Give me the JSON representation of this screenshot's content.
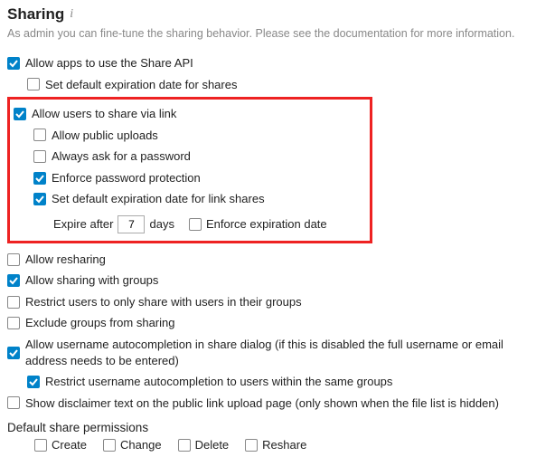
{
  "heading": "Sharing",
  "subtitle": "As admin you can fine-tune the sharing behavior. Please see the documentation for more information.",
  "options": {
    "share_api": "Allow apps to use the Share API",
    "default_exp": "Set default expiration date for shares",
    "share_link": "Allow users to share via link",
    "public_uploads": "Allow public uploads",
    "ask_password": "Always ask for a password",
    "enforce_password": "Enforce password protection",
    "default_exp_link": "Set default expiration date for link shares",
    "expire_after_pre": "Expire after",
    "expire_after_val": "7",
    "expire_after_post": "days",
    "enforce_exp": "Enforce expiration date",
    "resharing": "Allow resharing",
    "sharing_groups": "Allow sharing with groups",
    "restrict_groups": "Restrict users to only share with users in their groups",
    "exclude_groups": "Exclude groups from sharing",
    "autocomplete": "Allow username autocompletion in share dialog (if this is disabled the full username or email address needs to be entered)",
    "restrict_autocomplete": "Restrict username autocompletion to users within the same groups",
    "disclaimer": "Show disclaimer text on the public link upload page (only shown when the file list is hidden)"
  },
  "defaults_label": "Default share permissions",
  "perms": {
    "create": "Create",
    "change": "Change",
    "delete": "Delete",
    "reshare": "Reshare"
  }
}
